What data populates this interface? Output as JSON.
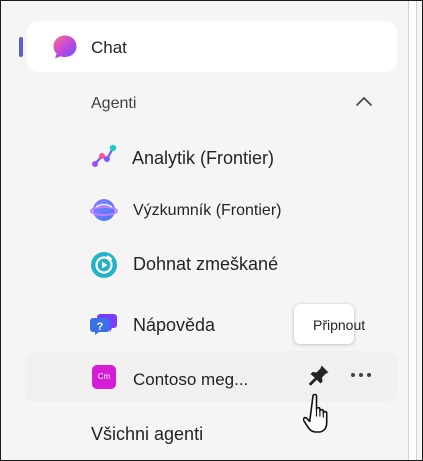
{
  "nav": {
    "chat_label": "Chat",
    "section_label": "Agenti",
    "agents": [
      {
        "label": "Analytik (Frontier)",
        "icon": "analytics-icon"
      },
      {
        "label": "Výzkumník (Frontier)",
        "icon": "researcher-icon"
      },
      {
        "label": "Dohnat zmeškané",
        "icon": "catch-up-icon"
      },
      {
        "label": "Nápověda",
        "icon": "help-icon"
      },
      {
        "label": "Contoso meg...",
        "icon": "contoso-icon",
        "icon_text": "Cm"
      }
    ],
    "all_agents_label": "Všichni agenti"
  },
  "tooltip": {
    "text": "Připnout"
  },
  "colors": {
    "accent": "#5b5fc7",
    "contoso": "#d61dd6",
    "chat_gradient_start": "#ff5c93",
    "chat_gradient_end": "#7b4dff"
  }
}
